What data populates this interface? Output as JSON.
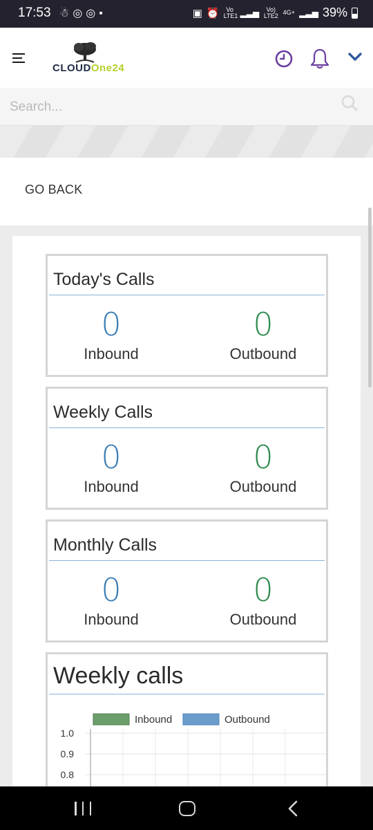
{
  "status_bar": {
    "time": "17:53",
    "left_icons": [
      "notification-icon",
      "instagram-icon",
      "instagram-icon",
      "dot-icon"
    ],
    "net_label_1": "Vo LTE1",
    "net_label_2": "Vo) LTE2",
    "net_label_3": "4G+",
    "battery": "39%"
  },
  "header": {
    "logo_text_a": "CLOUD",
    "logo_text_b": "One24",
    "icons": [
      "menu-icon",
      "clock-icon",
      "bell-icon",
      "chevron-down-icon"
    ],
    "accent_color": "#6a3ea0"
  },
  "search": {
    "placeholder": "Search..."
  },
  "nav": {
    "go_back": "GO BACK"
  },
  "stats": [
    {
      "title": "Today's Calls",
      "inbound": "0",
      "inbound_label": "Inbound",
      "outbound": "0",
      "outbound_label": "Outbound"
    },
    {
      "title": "Weekly Calls",
      "inbound": "0",
      "inbound_label": "Inbound",
      "outbound": "0",
      "outbound_label": "Outbound"
    },
    {
      "title": "Monthly Calls",
      "inbound": "0",
      "inbound_label": "Inbound",
      "outbound": "0",
      "outbound_label": "Outbound"
    }
  ],
  "chart_data": {
    "type": "bar",
    "title": "Weekly calls",
    "series": [
      {
        "name": "Inbound",
        "color": "#6a9e6a",
        "values": []
      },
      {
        "name": "Outbound",
        "color": "#6a9ccc",
        "values": []
      }
    ],
    "y_ticks": [
      "1.0",
      "0.9",
      "0.8"
    ],
    "legend": "top-center",
    "grid": true
  }
}
